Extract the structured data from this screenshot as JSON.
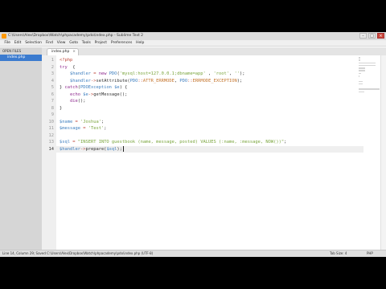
{
  "window": {
    "title": "C:\\Users\\Alex\\Dropbox\\Watch\\phpacademy\\pdo\\index.php - Sublime Text 2",
    "controls": [
      "–",
      "□",
      "×"
    ]
  },
  "menu": [
    "File",
    "Edit",
    "Selection",
    "Find",
    "View",
    "Goto",
    "Tools",
    "Project",
    "Preferences",
    "Help"
  ],
  "sidebar": {
    "header": "OPEN FILES",
    "files": [
      "index.php"
    ]
  },
  "tabs": [
    {
      "label": "index.php",
      "close": "×"
    }
  ],
  "editor": {
    "current_line": 14,
    "lines": [
      {
        "n": "1",
        "tokens": [
          [
            "op",
            "<?php"
          ]
        ]
      },
      {
        "n": "2",
        "tokens": [
          [
            "kw",
            "try"
          ],
          [
            "",
            "  {"
          ]
        ]
      },
      {
        "n": "3",
        "tokens": [
          [
            "",
            "    "
          ],
          [
            "var",
            "$handler"
          ],
          [
            "op",
            " = "
          ],
          [
            "kw",
            "new "
          ],
          [
            "var",
            "PDO"
          ],
          [
            "",
            "("
          ],
          [
            "str",
            "'mysql:host=127.0.0.1;dbname=app'"
          ],
          [
            "",
            " , "
          ],
          [
            "str",
            "'root'"
          ],
          [
            "",
            ", "
          ],
          [
            "str",
            "''"
          ],
          [
            "",
            ");"
          ]
        ]
      },
      {
        "n": "4",
        "tokens": [
          [
            "",
            "    "
          ],
          [
            "var",
            "$handler"
          ],
          [
            "op",
            "->"
          ],
          [
            "",
            "setAttribute("
          ],
          [
            "var",
            "PDO"
          ],
          [
            "op",
            "::"
          ],
          [
            "num",
            "ATTR_ERRMODE"
          ],
          [
            "",
            ", "
          ],
          [
            "var",
            "PDO"
          ],
          [
            "op",
            "::"
          ],
          [
            "num",
            "ERRMODE_EXCEPTION"
          ],
          [
            "",
            ");"
          ]
        ]
      },
      {
        "n": "5",
        "tokens": [
          [
            "",
            "} "
          ],
          [
            "kw",
            "catch"
          ],
          [
            "",
            "("
          ],
          [
            "var",
            "PDOException"
          ],
          [
            "",
            " "
          ],
          [
            "var",
            "$e"
          ],
          [
            "",
            ") {"
          ]
        ]
      },
      {
        "n": "6",
        "tokens": [
          [
            "",
            "    "
          ],
          [
            "kw",
            "echo"
          ],
          [
            "",
            " "
          ],
          [
            "var",
            "$e"
          ],
          [
            "op",
            "->"
          ],
          [
            "",
            "getMessage();"
          ]
        ]
      },
      {
        "n": "7",
        "tokens": [
          [
            "",
            "    "
          ],
          [
            "kw",
            "die"
          ],
          [
            "",
            "();"
          ]
        ]
      },
      {
        "n": "8",
        "tokens": [
          [
            "",
            "}"
          ]
        ]
      },
      {
        "n": "9",
        "tokens": []
      },
      {
        "n": "10",
        "tokens": [
          [
            "var",
            "$name"
          ],
          [
            "op",
            " = "
          ],
          [
            "str",
            "'Joshua'"
          ],
          [
            "",
            ";"
          ]
        ]
      },
      {
        "n": "11",
        "tokens": [
          [
            "var",
            "$message"
          ],
          [
            "op",
            " = "
          ],
          [
            "str",
            "'Test'"
          ],
          [
            "",
            ";"
          ]
        ]
      },
      {
        "n": "12",
        "tokens": []
      },
      {
        "n": "13",
        "tokens": [
          [
            "var",
            "$sql"
          ],
          [
            "op",
            " = "
          ],
          [
            "str",
            "\"INSERT INTO guestbook (name, message, posted) VALUES (:name, :message, NOW())\""
          ],
          [
            "",
            ";"
          ]
        ]
      },
      {
        "n": "14",
        "tokens": [
          [
            "var",
            "$handler"
          ],
          [
            "op",
            "->"
          ],
          [
            "",
            "prepare("
          ],
          [
            "var",
            "$sql"
          ],
          [
            "",
            ");"
          ]
        ]
      }
    ]
  },
  "status": {
    "text": "Line 14, Column 29; Saved C:\\Users\\Alex\\Dropbox\\Watch\\phpacademy\\pdo\\index.php (UTF-8)",
    "tab_size": "Tab Size: 4",
    "syntax": "PHP"
  },
  "colors": {
    "keyword": "#8f2b8f",
    "variable": "#3f7fbf",
    "string": "#7aa53d",
    "operator": "#c04b3d",
    "constant": "#c5762f",
    "sidebar_selected": "#3b7bcf"
  }
}
